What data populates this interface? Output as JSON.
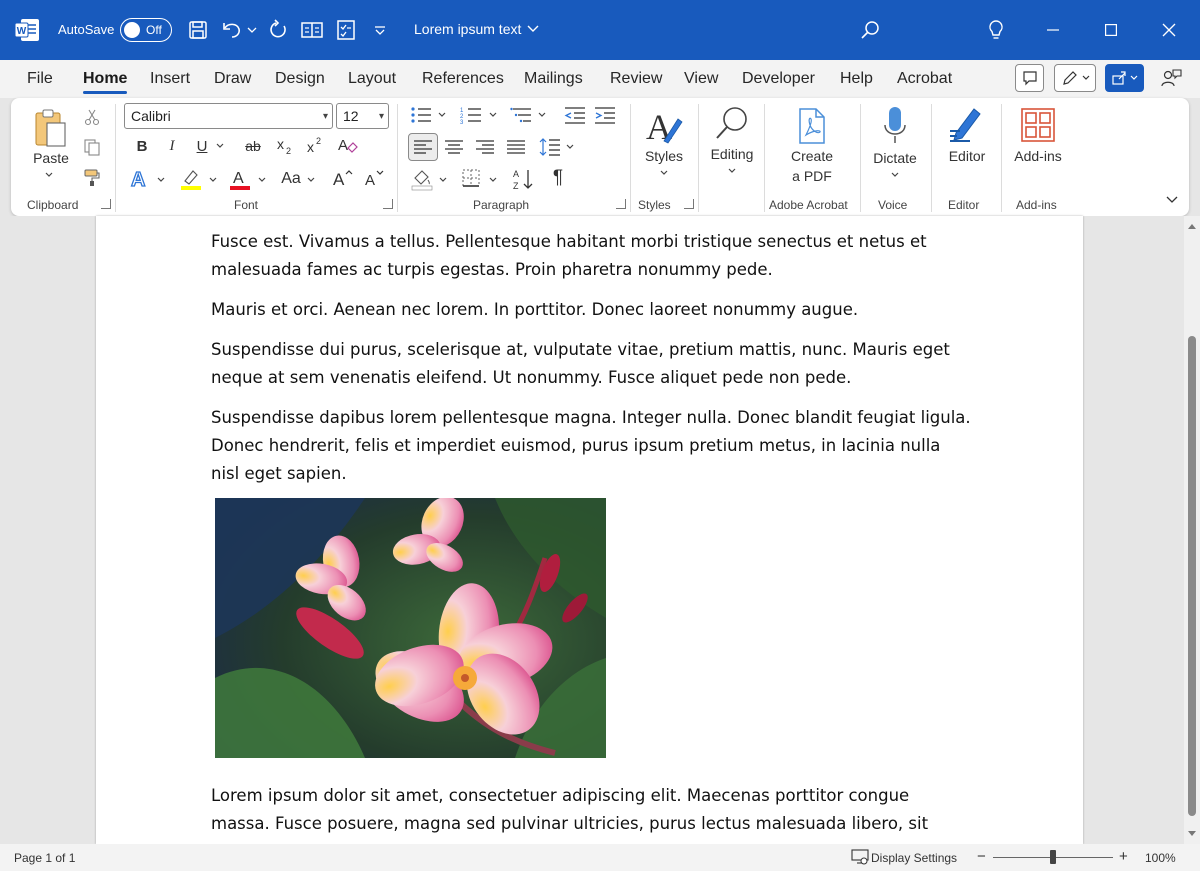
{
  "titlebar": {
    "autosave_label": "AutoSave",
    "autosave_state": "Off",
    "doc_title": "Lorem ipsum text",
    "brand_color": "#185abd"
  },
  "tabs": [
    "File",
    "Home",
    "Insert",
    "Draw",
    "Design",
    "Layout",
    "References",
    "Mailings",
    "Review",
    "View",
    "Developer",
    "Help",
    "Acrobat"
  ],
  "ribbon": {
    "clipboard": {
      "paste_label": "Paste",
      "group_label": "Clipboard"
    },
    "font": {
      "font_name": "Calibri",
      "font_size": "12",
      "group_label": "Font",
      "case_label": "Aa"
    },
    "paragraph": {
      "group_label": "Paragraph"
    },
    "styles": {
      "label": "Styles",
      "group_label": "Styles"
    },
    "editing": {
      "label": "Editing"
    },
    "acrobat": {
      "label_line1": "Create",
      "label_line2": "a PDF",
      "group_label": "Adobe Acrobat"
    },
    "voice": {
      "label": "Dictate",
      "group_label": "Voice"
    },
    "editor": {
      "label": "Editor",
      "group_label": "Editor"
    },
    "addins": {
      "label": "Add-ins",
      "group_label": "Add-ins"
    }
  },
  "document": {
    "paragraphs": [
      "Fusce est. Vivamus a tellus. Pellentesque habitant morbi tristique senectus et netus et malesuada fames ac turpis egestas. Proin pharetra nonummy pede.",
      "Mauris et orci. Aenean nec lorem. In porttitor. Donec laoreet nonummy augue.",
      "Suspendisse dui purus, scelerisque at, vulputate vitae, pretium mattis, nunc. Mauris eget neque at sem venenatis eleifend. Ut nonummy. Fusce aliquet pede non pede.",
      "Suspendisse dapibus lorem pellentesque magna. Integer nulla. Donec blandit feugiat ligula. Donec hendrerit, felis et imperdiet euismod, purus ipsum pretium metus, in lacinia nulla nisl eget sapien.",
      "Lorem ipsum dolor sit amet, consectetuer adipiscing elit. Maecenas porttitor congue massa. Fusce posuere, magna sed pulvinar ultricies, purus lectus malesuada libero, sit amet commodo"
    ]
  },
  "statusbar": {
    "page_info": "Page 1 of 1",
    "display_settings": "Display Settings",
    "zoom_minus": "−",
    "zoom_plus": "+",
    "zoom": "100%"
  }
}
